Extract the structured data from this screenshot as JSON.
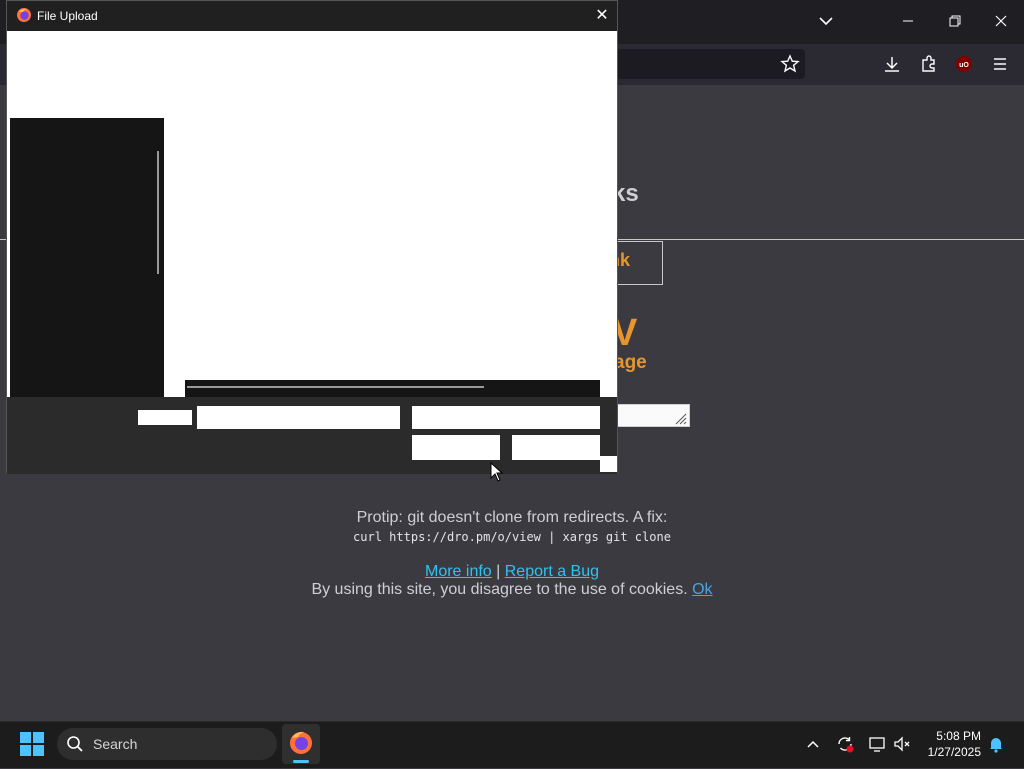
{
  "dialog": {
    "title": "File Upload",
    "close_glyph": "✕"
  },
  "page": {
    "heading_partial": "ks",
    "link_partial": "nk",
    "big_partial": "V",
    "subtitle_partial": "age",
    "protip": "Protip: git doesn't clone from redirects. A fix:",
    "protip_code": "curl https://dro.pm/o/view | xargs git clone",
    "more_info": "More info",
    "separator": " | ",
    "report_bug": "Report a Bug",
    "cookie_text": "By using this site, you disagree to the use of cookies.",
    "cookie_ok": "Ok"
  },
  "taskbar": {
    "search_label": "Search",
    "time": "5:08 PM",
    "date": "1/27/2025"
  },
  "colors": {
    "accent_orange": "#e8962b",
    "link_cyan": "#2ec3f0",
    "taskbar_accent": "#4cc2ff"
  },
  "icons": [
    "firefox-icon",
    "close-icon",
    "chevron-down-icon",
    "minimize-icon",
    "restore-icon",
    "bookmark-star-icon",
    "download-icon",
    "extensions-icon",
    "ublock-icon",
    "menu-icon",
    "windows-start-icon",
    "search-icon",
    "chevron-up-icon",
    "sync-icon",
    "network-icon",
    "volume-muted-icon",
    "notification-bell-icon",
    "mouse-cursor-icon",
    "resize-grip-icon"
  ]
}
